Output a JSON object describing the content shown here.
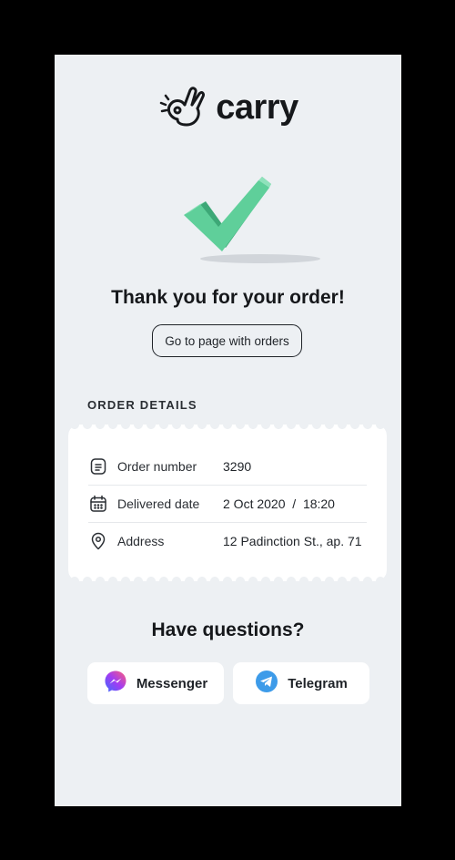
{
  "brand": {
    "name": "carry"
  },
  "confirmation": {
    "title": "Thank you for your order!",
    "orders_button_label": "Go to page with orders"
  },
  "order_details": {
    "section_label": "ORDER DETAILS",
    "rows": [
      {
        "icon": "receipt-icon",
        "label": "Order number",
        "value": "3290"
      },
      {
        "icon": "calendar-icon",
        "label": "Delivered date",
        "value": "2 Oct 2020  /  18:20"
      },
      {
        "icon": "location-pin-icon",
        "label": "Address",
        "value": "12 Padinction St., ap. 71"
      }
    ]
  },
  "support": {
    "title": "Have questions?",
    "buttons": [
      {
        "icon": "messenger-icon",
        "label": "Messenger"
      },
      {
        "icon": "telegram-icon",
        "label": "Telegram"
      }
    ]
  },
  "colors": {
    "background": "#edf0f3",
    "card": "#ffffff",
    "text": "#16181b",
    "checkmark": "#5fcf9a",
    "telegram": "#3d9be9"
  }
}
